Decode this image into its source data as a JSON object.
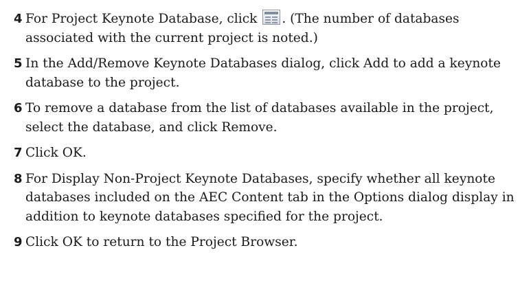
{
  "steps": [
    {
      "number": "4",
      "text_before": "For Project Keynote Database, click",
      "icon": "database-list-icon",
      "text_after": ". (The number of databases associated with the current project is noted.)"
    },
    {
      "number": "5",
      "text": "In the Add/Remove Keynote Databases dialog, click Add to add a keynote database to the project."
    },
    {
      "number": "6",
      "text": "To remove a database from the list of databases available in the project, select the database, and click Remove."
    },
    {
      "number": "7",
      "text": "Click OK."
    },
    {
      "number": "8",
      "text": "For Display Non-Project Keynote Databases, specify whether all keynote databases included on the AEC Content tab in the Options dialog display in addition to keynote databases specified for the project."
    },
    {
      "number": "9",
      "text": "Click OK to return to the Project Browser."
    }
  ]
}
